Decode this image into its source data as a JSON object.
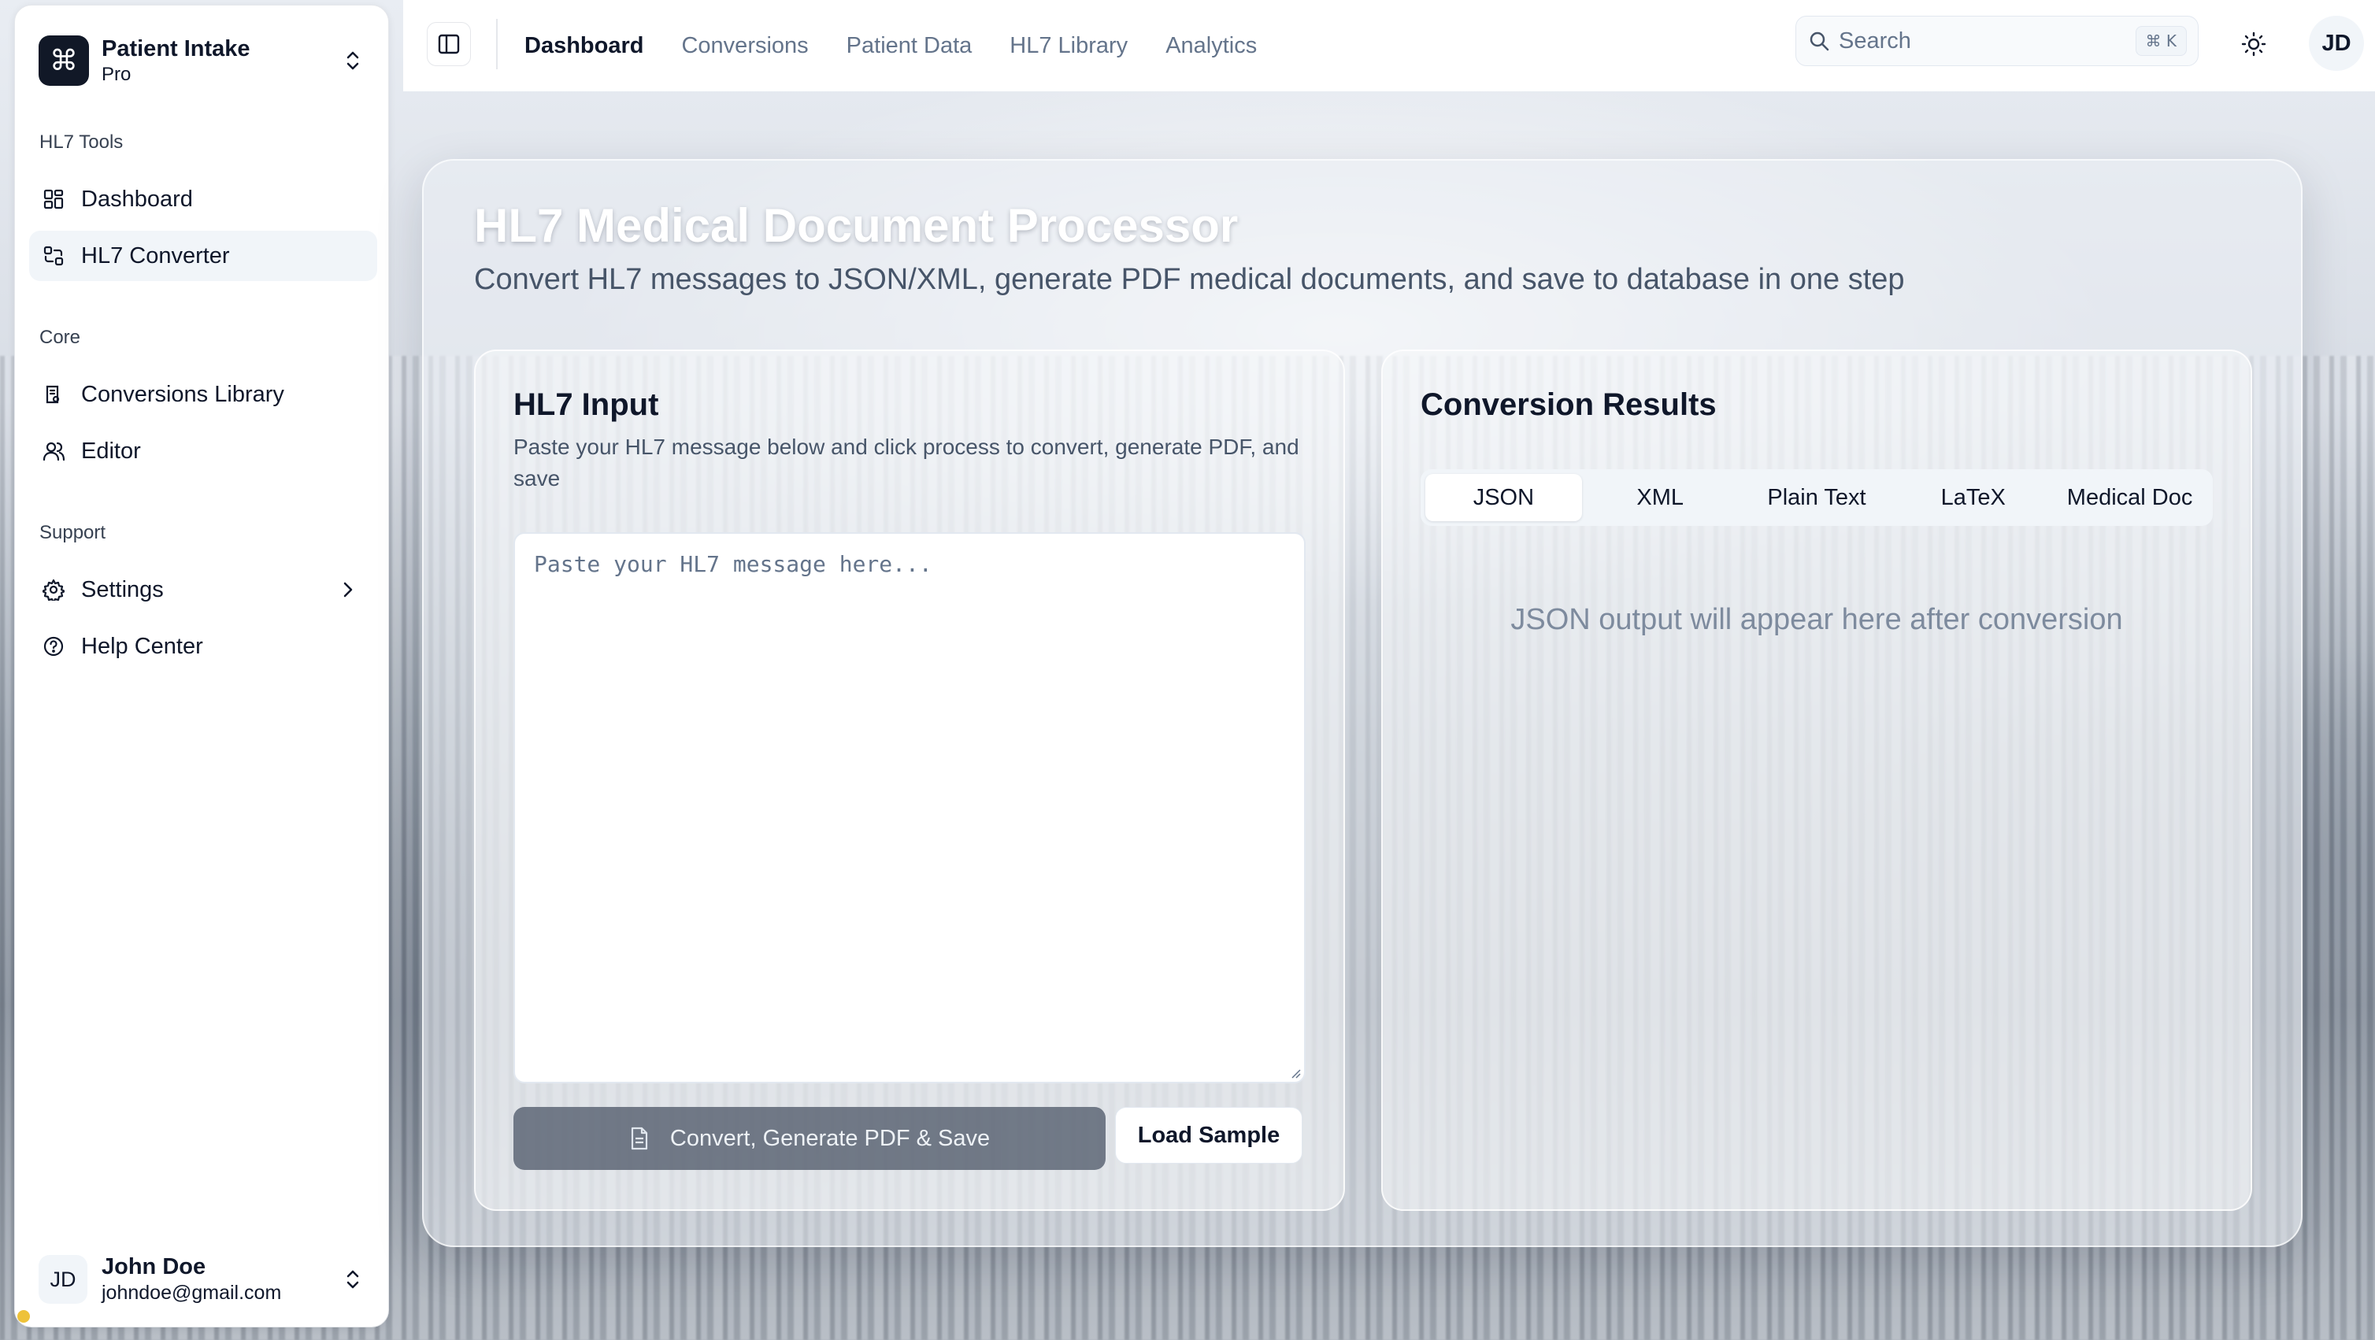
{
  "team": {
    "name": "Patient Intake",
    "plan": "Pro"
  },
  "sidebar": {
    "groups": [
      {
        "label": "HL7 Tools"
      },
      {
        "label": "Core"
      },
      {
        "label": "Support"
      }
    ],
    "items": [
      {
        "label": "Dashboard",
        "icon": "grid-icon"
      },
      {
        "label": "HL7 Converter",
        "icon": "convert-icon"
      },
      {
        "label": "Conversions Library",
        "icon": "library-icon"
      },
      {
        "label": "Editor",
        "icon": "users-icon"
      },
      {
        "label": "Settings",
        "icon": "gear-icon"
      },
      {
        "label": "Help Center",
        "icon": "help-icon"
      }
    ]
  },
  "user": {
    "initials": "JD",
    "name": "John Doe",
    "email": "johndoe@gmail.com"
  },
  "topbar": {
    "tabs": [
      "Dashboard",
      "Conversions",
      "Patient Data",
      "HL7 Library",
      "Analytics"
    ],
    "search_label": "Search",
    "shortcut": "⌘ K",
    "avatar": "JD"
  },
  "main": {
    "title": "HL7 Medical Document Processor",
    "subtitle": "Convert HL7 messages to JSON/XML, generate PDF medical documents, and save to database in one step",
    "input_card": {
      "title": "HL7 Input",
      "description": "Paste your HL7 message below and click process to convert, generate PDF, and save",
      "placeholder": "Paste your HL7 message here...",
      "convert_label": "Convert, Generate PDF & Save",
      "sample_label": "Load Sample"
    },
    "results_card": {
      "title": "Conversion Results",
      "tabs": [
        "JSON",
        "XML",
        "Plain Text",
        "LaTeX",
        "Medical Doc"
      ],
      "empty_text": "JSON output will appear here after conversion"
    }
  }
}
